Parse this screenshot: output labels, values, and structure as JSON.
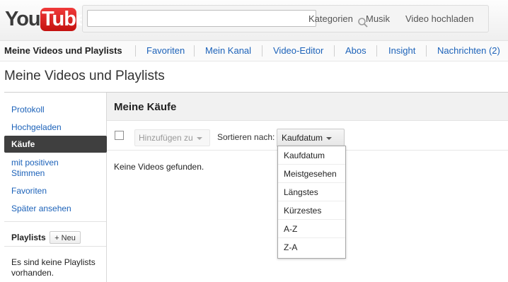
{
  "logo": {
    "you": "You",
    "tube": "Tube"
  },
  "search": {
    "placeholder": "",
    "value": ""
  },
  "masthead": {
    "links": [
      "Kategorien",
      "Musik",
      "Video hochladen"
    ]
  },
  "nav": {
    "items": [
      "Meine Videos und Playlists",
      "Favoriten",
      "Mein Kanal",
      "Video-Editor",
      "Abos",
      "Insight",
      "Nachrichten (2)"
    ]
  },
  "page": {
    "title": "Meine Videos und Playlists"
  },
  "sidebar": {
    "items": [
      "Protokoll",
      "Hochgeladen",
      "Käufe",
      "mit positiven Stimmen",
      "Favoriten",
      "Später ansehen"
    ],
    "active": "Käufe",
    "playlists_label": "Playlists",
    "new_button": "+ Neu",
    "empty_note": "Es sind keine Playlists vorhanden."
  },
  "content": {
    "title": "Meine Käufe",
    "add_button": "Hinzufügen zu",
    "sort_label": "Sortieren nach:",
    "sort_value": "Kaufdatum",
    "empty_note": "Keine Videos gefunden."
  },
  "sort_options": [
    "Kaufdatum",
    "Meistgesehen",
    "Längstes",
    "Kürzestes",
    "A-Z",
    "Z-A"
  ],
  "colors": {
    "brand_red": "#cc181e",
    "link": "#1c62b9",
    "active_bg": "#3f3f3f"
  }
}
